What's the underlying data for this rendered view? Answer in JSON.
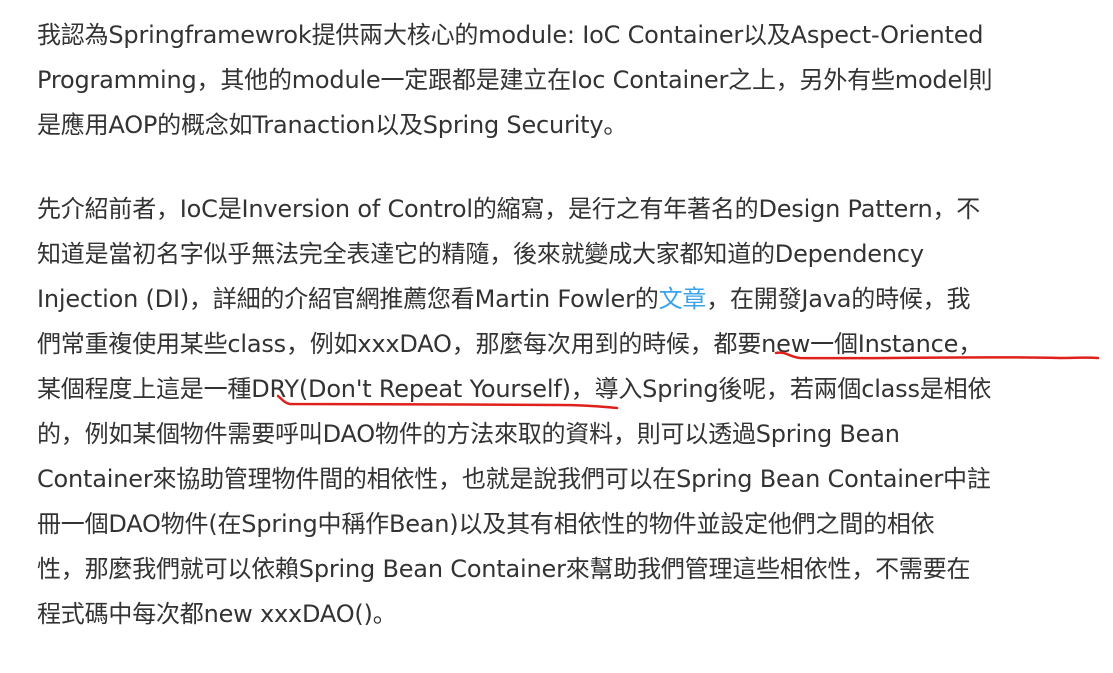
{
  "paragraph1": {
    "line1": "我認為Springframewrok提供兩大核心的module: IoC Container以及Aspect-Oriented",
    "line2": "Programming，其他的module一定跟都是建立在Ioc Container之上，另外有些model則",
    "line3": "是應用AOP的概念如Tranaction以及Spring Security。"
  },
  "paragraph2": {
    "line1": "先介紹前者，IoC是Inversion of Control的縮寫，是行之有年著名的Design Pattern，不",
    "line2": "知道是當初名字似乎無法完全表達它的精隨，後來就變成大家都知道的Dependency",
    "line3_before_link": "Injection (DI)，詳細的介紹官網推薦您看Martin Fowler的",
    "link_text": "文章",
    "line3_after_link": "，在開發Java的時候，我",
    "line4_before": "們常重複使用某些class，例如xxxDAO，那麼每次用到的時候",
    "line4_emphasis": "，都要new一個Instance，",
    "line5_before": "某個程度上這是一種",
    "line5_emphasis": "DRY(Don't Repeat Yourself)",
    "line5_after": "，導入Spring後呢，若兩個class是相依",
    "line6": "的，例如某個物件需要呼叫DAO物件的方法來取的資料，則可以透過Spring Bean",
    "line7": "Container來協助管理物件間的相依性，也就是說我們可以在Spring Bean Container中註",
    "line8": "冊一個DAO物件(在Spring中稱作Bean)以及其有相依性的物件並設定他們之間的相依",
    "line9": "性，那麼我們就可以依賴Spring Bean Container來幫助我們管理這些相依性，不需要在",
    "line10": "程式碼中每次都new xxxDAO()。"
  },
  "colors": {
    "text": "#333333",
    "link": "#3ba3ea",
    "annotation": "#e0211b"
  }
}
